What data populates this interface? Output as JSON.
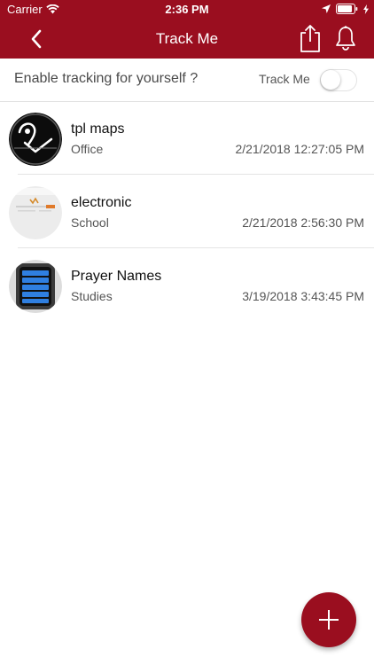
{
  "status_bar": {
    "carrier": "Carrier",
    "time": "2:36 PM",
    "icons": [
      "wifi-icon",
      "location-arrow-icon",
      "battery-icon",
      "charging-icon"
    ]
  },
  "nav": {
    "title": "Track Me",
    "back_icon": "chevron-left-icon",
    "share_icon": "share-icon",
    "bell_icon": "bell-icon",
    "bar_color": "#9a0e1f"
  },
  "tracking": {
    "prompt": "Enable tracking for yourself ?",
    "toggle_label": "Track Me",
    "toggle_on": false
  },
  "items": [
    {
      "name": "tpl maps",
      "category": "Office",
      "date": "2/21/2018 12:27:05 PM",
      "thumb": "map-pin-thumbnail"
    },
    {
      "name": "electronic",
      "category": "School",
      "date": "2/21/2018 2:56:30 PM",
      "thumb": "web-page-thumbnail"
    },
    {
      "name": "Prayer Names",
      "category": "Studies",
      "date": "3/19/2018 3:43:45 PM",
      "thumb": "smartwatch-thumbnail"
    }
  ],
  "fab": {
    "icon": "plus-icon",
    "color": "#9a0e1f"
  }
}
